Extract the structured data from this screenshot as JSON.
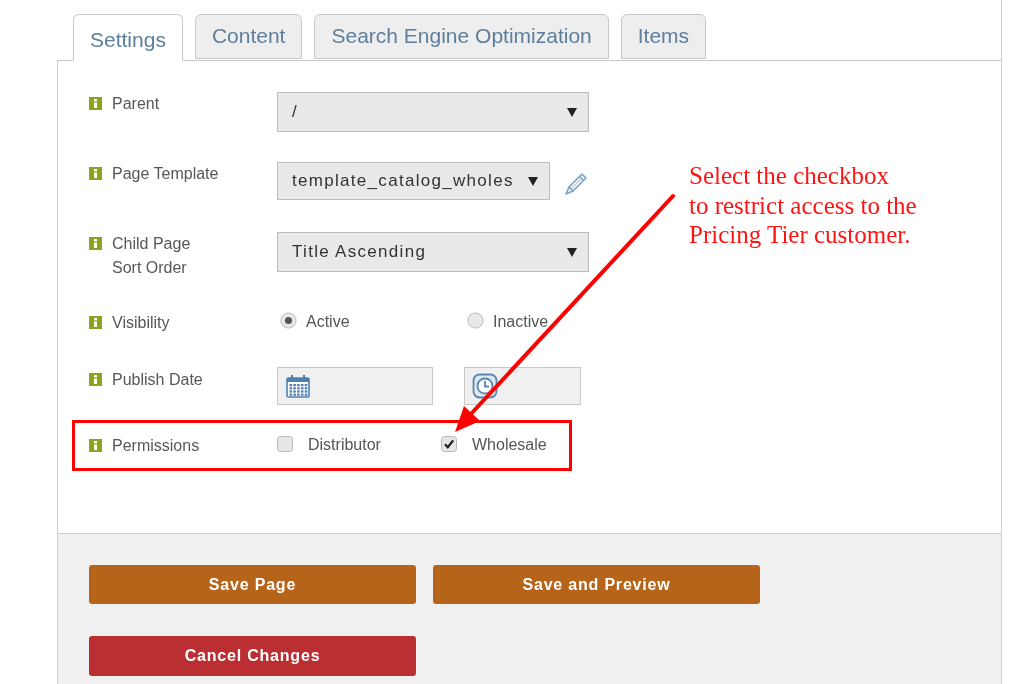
{
  "tabs": [
    {
      "label": "Settings",
      "selected": true
    },
    {
      "label": "Content",
      "selected": false
    },
    {
      "label": "Search Engine Optimization",
      "selected": false
    },
    {
      "label": "Items",
      "selected": false
    }
  ],
  "fields": [
    {
      "kind": "select",
      "label": "Parent",
      "value": "/"
    },
    {
      "kind": "select",
      "label": "Page Template",
      "value": "template_catalog_wholes",
      "edit_button": true
    },
    {
      "kind": "select",
      "label": "Child Page Sort Order",
      "value": "Title Ascending"
    },
    {
      "kind": "radio",
      "label": "Visibility",
      "options": [
        {
          "label": "Active",
          "selected": true
        },
        {
          "label": "Inactive",
          "selected": false
        }
      ]
    },
    {
      "kind": "datetime",
      "label": "Publish Date"
    },
    {
      "kind": "checkbox",
      "label": "Permissions",
      "highlighted": true,
      "options": [
        {
          "label": "Distributor",
          "checked": false
        },
        {
          "label": "Wholesale",
          "checked": true
        }
      ]
    }
  ],
  "annotation": {
    "text": "Select the checkbox\nto restrict access to the\nPricing Tier customer."
  },
  "buttons": [
    {
      "label": "Save Page",
      "kind": "primary"
    },
    {
      "label": "Save and Preview",
      "kind": "primary"
    },
    {
      "label": "Cancel Changes",
      "kind": "danger"
    }
  ]
}
